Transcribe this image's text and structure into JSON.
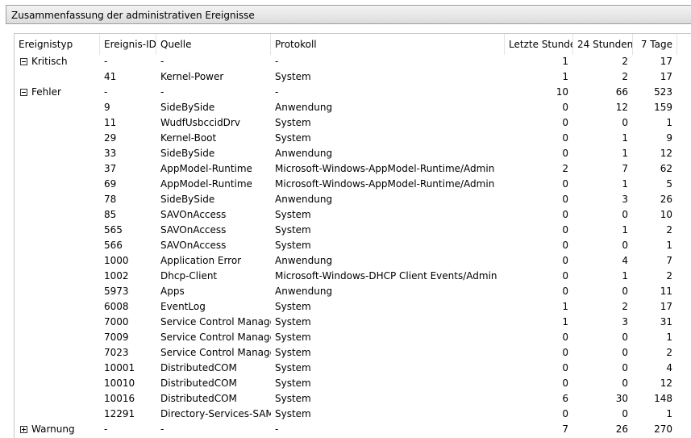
{
  "panel": {
    "title": "Zusammenfassung der administrativen Ereignisse"
  },
  "columns": [
    "Ereignistyp",
    "Ereignis-ID",
    "Quelle",
    "Protokoll",
    "Letzte Stunde",
    "24 Stunden",
    "7 Tage"
  ],
  "rows": [
    {
      "type": "Kritisch",
      "expander": "minus",
      "id": "-",
      "source": "-",
      "log": "-",
      "hour": "1",
      "day": "2",
      "week": "17"
    },
    {
      "type": "",
      "id": "41",
      "source": "Kernel-Power",
      "log": "System",
      "hour": "1",
      "day": "2",
      "week": "17"
    },
    {
      "type": "Fehler",
      "expander": "minus",
      "id": "-",
      "source": "-",
      "log": "-",
      "hour": "10",
      "day": "66",
      "week": "523"
    },
    {
      "type": "",
      "id": "9",
      "source": "SideBySide",
      "log": "Anwendung",
      "hour": "0",
      "day": "12",
      "week": "159"
    },
    {
      "type": "",
      "id": "11",
      "source": "WudfUsbccidDrv",
      "log": "System",
      "hour": "0",
      "day": "0",
      "week": "1"
    },
    {
      "type": "",
      "id": "29",
      "source": "Kernel-Boot",
      "log": "System",
      "hour": "0",
      "day": "1",
      "week": "9"
    },
    {
      "type": "",
      "id": "33",
      "source": "SideBySide",
      "log": "Anwendung",
      "hour": "0",
      "day": "1",
      "week": "12"
    },
    {
      "type": "",
      "id": "37",
      "source": "AppModel-Runtime",
      "log": "Microsoft-Windows-AppModel-Runtime/Admin",
      "hour": "2",
      "day": "7",
      "week": "62"
    },
    {
      "type": "",
      "id": "69",
      "source": "AppModel-Runtime",
      "log": "Microsoft-Windows-AppModel-Runtime/Admin",
      "hour": "0",
      "day": "1",
      "week": "5"
    },
    {
      "type": "",
      "id": "78",
      "source": "SideBySide",
      "log": "Anwendung",
      "hour": "0",
      "day": "3",
      "week": "26"
    },
    {
      "type": "",
      "id": "85",
      "source": "SAVOnAccess",
      "log": "System",
      "hour": "0",
      "day": "0",
      "week": "10"
    },
    {
      "type": "",
      "id": "565",
      "source": "SAVOnAccess",
      "log": "System",
      "hour": "0",
      "day": "1",
      "week": "2"
    },
    {
      "type": "",
      "id": "566",
      "source": "SAVOnAccess",
      "log": "System",
      "hour": "0",
      "day": "0",
      "week": "1"
    },
    {
      "type": "",
      "id": "1000",
      "source": "Application Error",
      "log": "Anwendung",
      "hour": "0",
      "day": "4",
      "week": "7"
    },
    {
      "type": "",
      "id": "1002",
      "source": "Dhcp-Client",
      "log": "Microsoft-Windows-DHCP Client Events/Admin",
      "hour": "0",
      "day": "1",
      "week": "2"
    },
    {
      "type": "",
      "id": "5973",
      "source": "Apps",
      "log": "Anwendung",
      "hour": "0",
      "day": "0",
      "week": "11"
    },
    {
      "type": "",
      "id": "6008",
      "source": "EventLog",
      "log": "System",
      "hour": "1",
      "day": "2",
      "week": "17"
    },
    {
      "type": "",
      "id": "7000",
      "source": "Service Control Manager",
      "log": "System",
      "hour": "1",
      "day": "3",
      "week": "31"
    },
    {
      "type": "",
      "id": "7009",
      "source": "Service Control Manager",
      "log": "System",
      "hour": "0",
      "day": "0",
      "week": "1"
    },
    {
      "type": "",
      "id": "7023",
      "source": "Service Control Manager",
      "log": "System",
      "hour": "0",
      "day": "0",
      "week": "2"
    },
    {
      "type": "",
      "id": "10001",
      "source": "DistributedCOM",
      "log": "System",
      "hour": "0",
      "day": "0",
      "week": "4"
    },
    {
      "type": "",
      "id": "10010",
      "source": "DistributedCOM",
      "log": "System",
      "hour": "0",
      "day": "0",
      "week": "12"
    },
    {
      "type": "",
      "id": "10016",
      "source": "DistributedCOM",
      "log": "System",
      "hour": "6",
      "day": "30",
      "week": "148"
    },
    {
      "type": "",
      "id": "12291",
      "source": "Directory-Services-SAM",
      "log": "System",
      "hour": "0",
      "day": "0",
      "week": "1"
    },
    {
      "type": "Warnung",
      "expander": "plus",
      "id": "-",
      "source": "-",
      "log": "-",
      "hour": "7",
      "day": "26",
      "week": "270"
    }
  ]
}
